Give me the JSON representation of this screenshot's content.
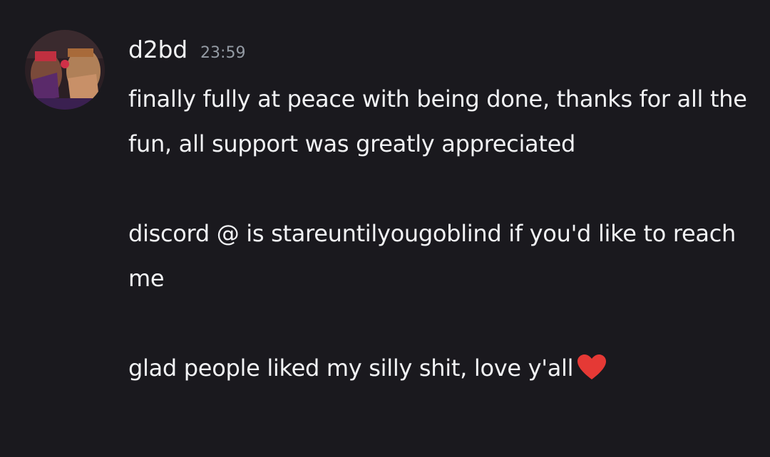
{
  "message": {
    "author": "d2bd",
    "timestamp": "23:59",
    "avatar_icon": "user-avatar",
    "paragraphs": [
      "finally fully at peace with being done, thanks for all the fun, all support was greatly appreciated",
      "discord @ is stareuntilyougoblind if you'd like to reach me",
      "glad people liked my silly shit, love y'all"
    ],
    "emoji": "red-heart-emoji"
  },
  "colors": {
    "background": "#1a191e",
    "text": "#f2f3f5",
    "timestamp": "#949ba4",
    "heart": "#e53935"
  }
}
